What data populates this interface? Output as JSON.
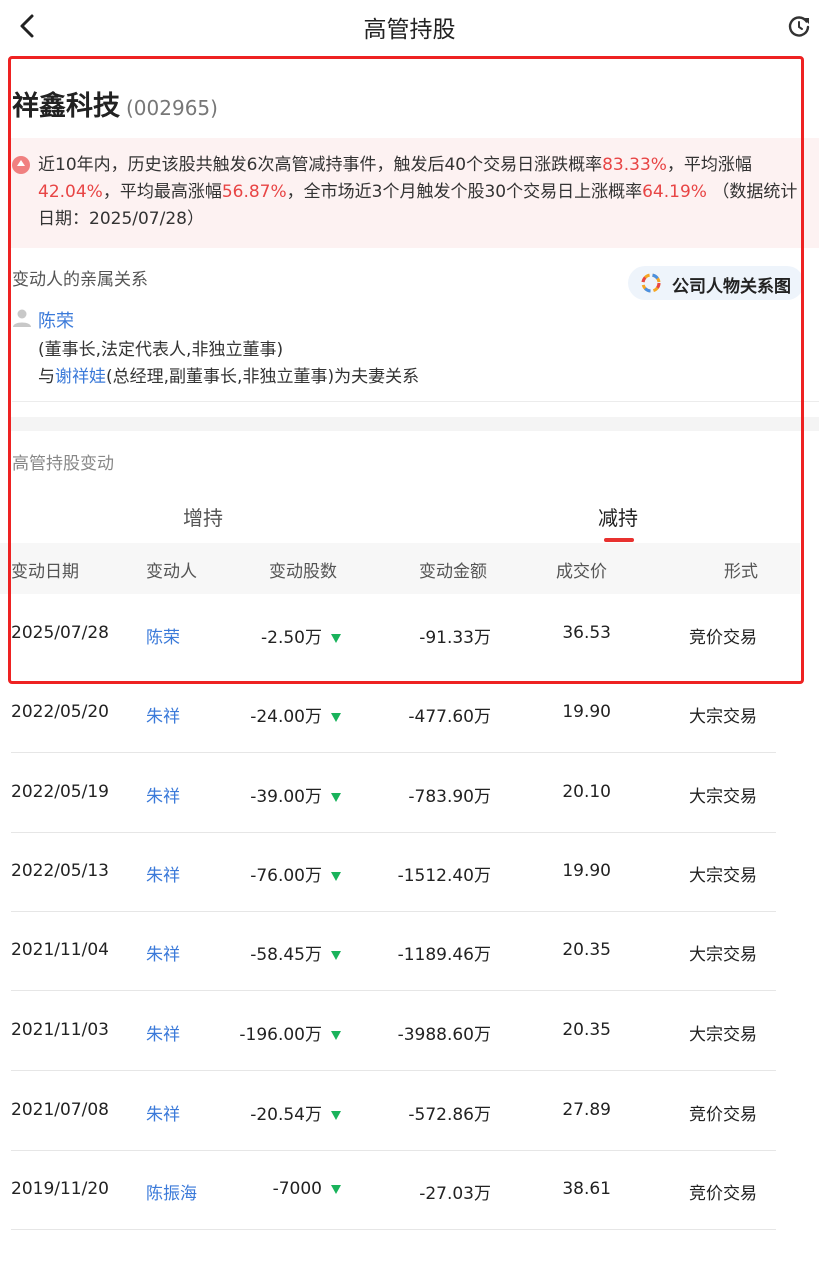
{
  "header": {
    "title": "高管持股"
  },
  "stock": {
    "name": "祥鑫科技",
    "code": "(002965)"
  },
  "notice": {
    "t1": "近10年内，历史该股共触发6次高管减持事件，触发后40个交易日涨跌概率",
    "v1": "83.33%",
    "t2": "，平均涨幅",
    "v2": "42.04%",
    "t3": "，平均最高涨幅",
    "v3": "56.87%",
    "t4": "，全市场近3个月触发个股30个交易日上涨概率",
    "v4": "64.19%",
    "t5": " （数据统计日期：2025/07/28）"
  },
  "relation": {
    "label": "变动人的亲属关系",
    "button": "公司人物关系图",
    "person": "陈荣",
    "role": "(董事长,法定代表人,非独立董事)",
    "prefix": "与",
    "related_person": "谢祥娃",
    "suffix": "(总经理,副董事长,非独立董事)为夫妻关系"
  },
  "holdings": {
    "label": "高管持股变动",
    "tab_increase": "增持",
    "tab_decrease": "减持",
    "columns": [
      "变动日期",
      "变动人",
      "变动股数",
      "变动金额",
      "成交价",
      "形式"
    ],
    "rows": [
      {
        "date": "2025/07/28",
        "person": "陈荣",
        "shares": "-2.50万",
        "amount": "-91.33万",
        "price": "36.53",
        "form": "竞价交易"
      },
      {
        "date": "2022/05/20",
        "person": "朱祥",
        "shares": "-24.00万",
        "amount": "-477.60万",
        "price": "19.90",
        "form": "大宗交易"
      },
      {
        "date": "2022/05/19",
        "person": "朱祥",
        "shares": "-39.00万",
        "amount": "-783.90万",
        "price": "20.10",
        "form": "大宗交易"
      },
      {
        "date": "2022/05/13",
        "person": "朱祥",
        "shares": "-76.00万",
        "amount": "-1512.40万",
        "price": "19.90",
        "form": "大宗交易"
      },
      {
        "date": "2021/11/04",
        "person": "朱祥",
        "shares": "-58.45万",
        "amount": "-1189.46万",
        "price": "20.35",
        "form": "大宗交易"
      },
      {
        "date": "2021/11/03",
        "person": "朱祥",
        "shares": "-196.00万",
        "amount": "-3988.60万",
        "price": "20.35",
        "form": "大宗交易"
      },
      {
        "date": "2021/07/08",
        "person": "朱祥",
        "shares": "-20.54万",
        "amount": "-572.86万",
        "price": "27.89",
        "form": "竞价交易"
      },
      {
        "date": "2019/11/20",
        "person": "陈振海",
        "shares": "-7000",
        "amount": "-27.03万",
        "price": "38.61",
        "form": "竞价交易"
      }
    ]
  },
  "colors": {
    "accent_red": "#e84545",
    "link_blue": "#3b7ad9",
    "down_green": "#19b35b"
  },
  "icons": {
    "back": "chevron-left-icon",
    "refresh": "refresh-icon",
    "person": "person-icon",
    "relation": "ring-chart-icon",
    "down": "triangle-down-icon"
  }
}
